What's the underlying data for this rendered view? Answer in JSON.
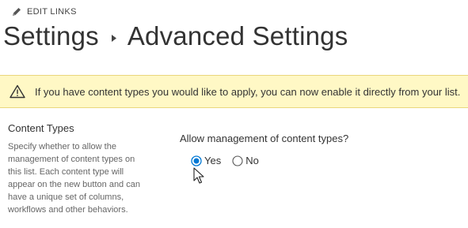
{
  "header": {
    "edit_links_label": "EDIT LINKS",
    "edit_icon": "pencil-icon"
  },
  "breadcrumb": {
    "parent": "Settings",
    "separator_icon": "triangle-right-icon",
    "current": "Advanced Settings"
  },
  "banner": {
    "icon": "warning-icon",
    "message": "If you have content types you would like to apply, you can now enable it directly from your list.",
    "background_color": "#fff8c5",
    "border_color": "#ead67c"
  },
  "content_types_section": {
    "title": "Content Types",
    "description": "Specify whether to allow the management of content types on this list. Each content type will appear on the new button and can have a unique set of columns, workflows and other behaviors.",
    "question": "Allow management of content types?",
    "options": [
      {
        "label": "Yes",
        "selected": true
      },
      {
        "label": "No",
        "selected": false
      }
    ],
    "selected_color": "#0078d4"
  },
  "pointer": {
    "icon": "mouse-cursor-icon"
  }
}
